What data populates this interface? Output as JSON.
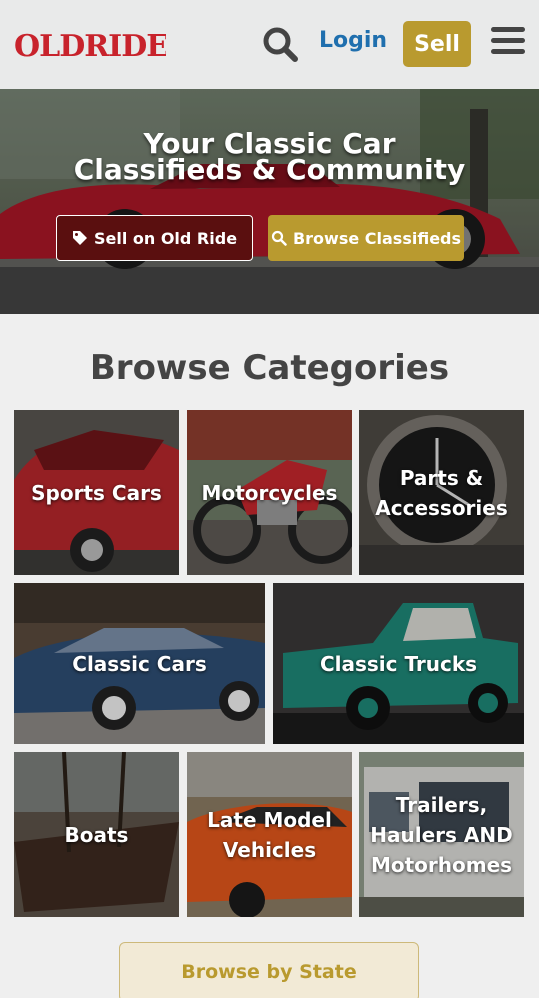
{
  "header": {
    "logo_text": "OLDRIDE",
    "login_label": "Login",
    "sell_label": "Sell",
    "search_icon": "search-icon",
    "menu_icon": "hamburger-menu-icon"
  },
  "hero": {
    "title_line1": "Your Classic Car",
    "title_line2": "Classifieds & Community",
    "sell_button_label": "Sell on Old Ride",
    "browse_button_label": "Browse Classifieds",
    "sell_button_icon": "tag-icon",
    "browse_button_icon": "search-icon"
  },
  "categories": {
    "title": "Browse Categories",
    "items": [
      {
        "label": "Sports Cars"
      },
      {
        "label": "Motorcycles"
      },
      {
        "label": "Parts & Accessories"
      },
      {
        "label": "Classic Cars"
      },
      {
        "label": "Classic Trucks"
      },
      {
        "label": "Boats"
      },
      {
        "label": "Late Model Vehicles"
      },
      {
        "label": "Trailers, Haulers AND Motorhomes"
      }
    ]
  },
  "browse_state_label": "Browse by State",
  "colors": {
    "brand_gold": "#b99a2f",
    "brand_blue": "#1f6fae",
    "brand_red": "#c8232c",
    "dark_red": "#5a0f0f"
  }
}
